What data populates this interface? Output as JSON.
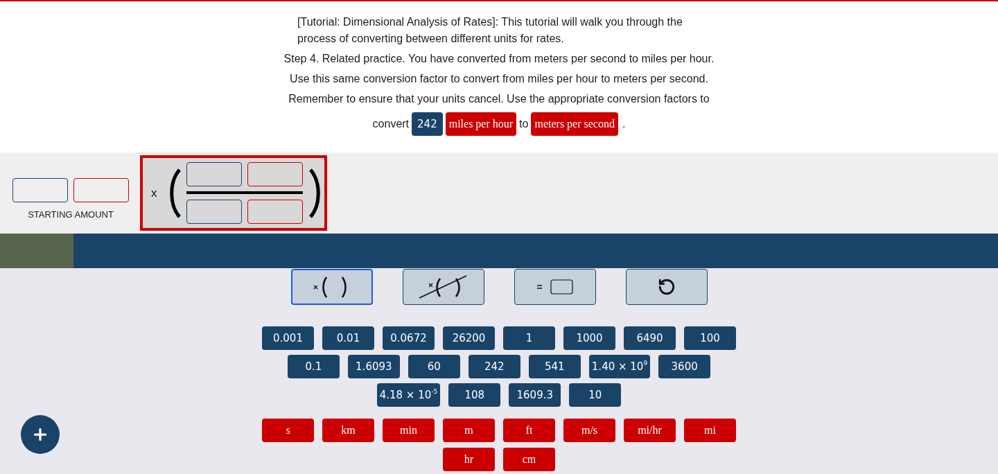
{
  "tutorial": {
    "intro": "[Tutorial: Dimensional Analysis of Rates]: This tutorial will walk you through the process of converting between different units for rates.",
    "instruction": "Step 4. Related practice. You have converted from meters per second to miles per hour. Use this same conversion factor to convert from miles per hour to meters per second. Remember to ensure that your units cancel. Use the appropriate conversion factors to",
    "convert_line": {
      "lead": "convert",
      "amount": "242",
      "from_unit": "miles per hour",
      "joiner": "to",
      "to_unit": "meters per second",
      "end": "."
    }
  },
  "workspace": {
    "starting_amount": {
      "label": "STARTING AMOUNT"
    },
    "factor": {
      "operator": "x",
      "selected": true
    }
  },
  "tools": [
    {
      "kind": "multiply",
      "selected": true
    },
    {
      "kind": "cancel",
      "selected": false
    },
    {
      "kind": "equals",
      "selected": false
    },
    {
      "kind": "undo",
      "selected": false
    }
  ],
  "numbers": [
    "0.001",
    "0.01",
    "0.0672",
    "26200",
    "1",
    "1000",
    "6490",
    "100",
    "0.1",
    "1.6093",
    "60",
    "242",
    "541",
    "1.40 × 10$^{9}$",
    "3600",
    "4.18 × 10$^{-5}$",
    "108",
    "1609.3",
    "10"
  ],
  "units": [
    "s",
    "km",
    "min",
    "m",
    "ft",
    "m/s",
    "mi/hr",
    "mi",
    "hr",
    "cm"
  ]
}
